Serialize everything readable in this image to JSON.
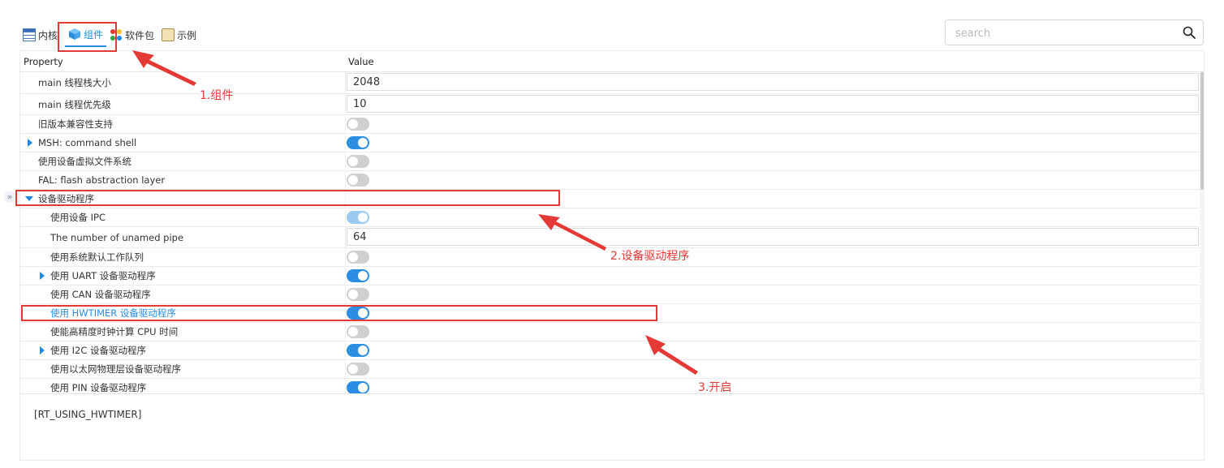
{
  "tabs": [
    {
      "label": "内核",
      "icon": "kernel-table-icon",
      "active": false
    },
    {
      "label": "组件",
      "icon": "component-cube-icon",
      "active": true
    },
    {
      "label": "软件包",
      "icon": "package-dots-icon",
      "active": false
    },
    {
      "label": "示例",
      "icon": "example-clipboard-icon",
      "active": false
    }
  ],
  "search": {
    "placeholder": "search",
    "value": "",
    "icon": "search-icon"
  },
  "grid": {
    "header": {
      "property": "Property",
      "value": "Value"
    },
    "rows": [
      {
        "label": "main 线程栈大小",
        "type": "input",
        "value": "2048",
        "indent": 1,
        "expander": "none"
      },
      {
        "label": "main 线程优先级",
        "type": "input",
        "value": "10",
        "indent": 1,
        "expander": "none"
      },
      {
        "label": "旧版本兼容性支持",
        "type": "toggle",
        "on": false,
        "indent": 1,
        "expander": "none"
      },
      {
        "label": "MSH: command shell",
        "type": "toggle",
        "on": true,
        "indent": 1,
        "expander": "collapsed"
      },
      {
        "label": "使用设备虚拟文件系统",
        "type": "toggle",
        "on": false,
        "indent": 1,
        "expander": "none"
      },
      {
        "label": "FAL: flash abstraction layer",
        "type": "toggle",
        "on": false,
        "indent": 1,
        "expander": "none"
      },
      {
        "label": "设备驱动程序",
        "type": "none",
        "indent": 1,
        "expander": "expanded"
      },
      {
        "label": "使用设备 IPC",
        "type": "toggle",
        "on": true,
        "disabled": true,
        "indent": 2,
        "expander": "none"
      },
      {
        "label": "The number of unamed pipe",
        "type": "input",
        "value": "64",
        "indent": 2,
        "expander": "none"
      },
      {
        "label": "使用系统默认工作队列",
        "type": "toggle",
        "on": false,
        "indent": 2,
        "expander": "none"
      },
      {
        "label": "使用 UART 设备驱动程序",
        "type": "toggle",
        "on": true,
        "indent": 2,
        "expander": "collapsed"
      },
      {
        "label": "使用 CAN 设备驱动程序",
        "type": "toggle",
        "on": false,
        "indent": 2,
        "expander": "none"
      },
      {
        "label": "使用 HWTIMER 设备驱动程序",
        "type": "toggle",
        "on": true,
        "indent": 2,
        "expander": "none",
        "selected": true
      },
      {
        "label": "使能高精度时钟计算 CPU 时间",
        "type": "toggle",
        "on": false,
        "indent": 2,
        "expander": "none"
      },
      {
        "label": "使用 I2C 设备驱动程序",
        "type": "toggle",
        "on": true,
        "indent": 2,
        "expander": "collapsed"
      },
      {
        "label": "使用以太网物理层设备驱动程序",
        "type": "toggle",
        "on": false,
        "indent": 2,
        "expander": "none"
      },
      {
        "label": "使用 PIN 设备驱动程序",
        "type": "toggle",
        "on": true,
        "indent": 2,
        "expander": "none"
      }
    ]
  },
  "description": "[RT_USING_HWTIMER]",
  "side_control": {
    "glyph": "»",
    "icon": "expand-panel-icon"
  },
  "annotations": [
    {
      "text": "1.组件"
    },
    {
      "text": "2.设备驱动程序"
    },
    {
      "text": "3.开启"
    }
  ],
  "colors": {
    "accent": "#2b8ee3",
    "annotation": "#e53935",
    "toggle_off": "#cfcfcf"
  }
}
